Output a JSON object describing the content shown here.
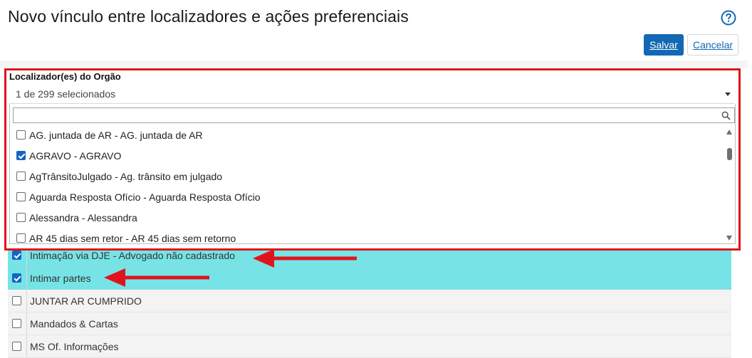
{
  "header": {
    "title": "Novo vínculo entre localizadores e ações preferenciais",
    "save_label": "Salvar",
    "cancel_label": "Cancelar"
  },
  "localizador_field": {
    "label": "Localizador(es) do Orgão",
    "value": "1 de 299 selecionados",
    "search_value": "",
    "options": [
      {
        "label": "AG. juntada de AR - AG. juntada de AR",
        "checked": false
      },
      {
        "label": "AGRAVO - AGRAVO",
        "checked": true
      },
      {
        "label": "AgTrânsitoJulgado - Ag. trânsito em julgado",
        "checked": false
      },
      {
        "label": "Aguarda Resposta Ofício - Aguarda Resposta Ofício",
        "checked": false
      },
      {
        "label": "Alessandra - Alessandra",
        "checked": false
      },
      {
        "label": "AR 45 dias sem retor - AR 45 dias sem retorno",
        "checked": false
      }
    ]
  },
  "actions_table": {
    "rows": [
      {
        "label": "Intimação via DJE - Advogado não cadastrado",
        "checked": true
      },
      {
        "label": "Intimar partes",
        "checked": true
      },
      {
        "label": "JUNTAR AR CUMPRIDO",
        "checked": false
      },
      {
        "label": "Mandados & Cartas",
        "checked": false
      },
      {
        "label": "MS Of. Informações",
        "checked": false
      }
    ]
  },
  "colors": {
    "highlight_border": "#e0141c",
    "selected_row": "#76e4e6",
    "primary": "#1268b3"
  },
  "icons": {
    "help": "help-circle-icon",
    "search": "search-icon",
    "annotation": "red-arrow-icon"
  }
}
